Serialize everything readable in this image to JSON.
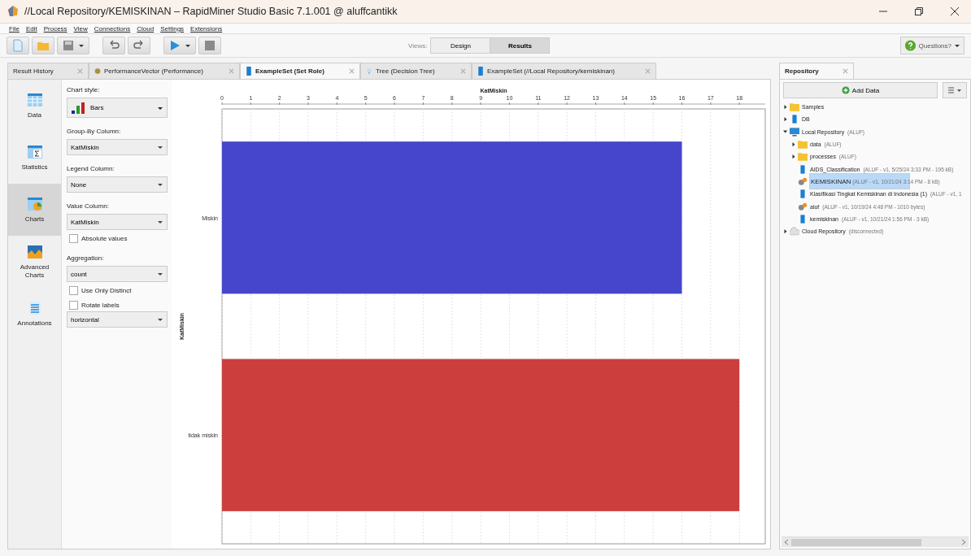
{
  "window": {
    "title": "//Local Repository/KEMISKINAN – RapidMiner Studio Basic 7.1.001 @ aluffcantikk"
  },
  "menu": [
    "File",
    "Edit",
    "Process",
    "View",
    "Connections",
    "Cloud",
    "Settings",
    "Extensions"
  ],
  "views": {
    "label": "Views:",
    "buttons": [
      {
        "label": "Design",
        "selected": false
      },
      {
        "label": "Results",
        "selected": true
      }
    ]
  },
  "questions": "Questions?",
  "result_tabs": [
    {
      "label": "Result History",
      "kind": "history",
      "selected": false
    },
    {
      "label": "PerformanceVector (Performance)",
      "kind": "performance",
      "selected": false
    },
    {
      "label": "ExampleSet (Set Role)",
      "kind": "data",
      "selected": true
    },
    {
      "label": "Tree (Decision Tree)",
      "kind": "tree",
      "selected": false
    },
    {
      "label": "ExampleSet (//Local Repository/kemiskinan)",
      "kind": "data",
      "selected": false
    }
  ],
  "nav": [
    {
      "label": "Data",
      "kind": "data",
      "selected": false
    },
    {
      "label": "Statistics",
      "kind": "statistics",
      "selected": false
    },
    {
      "label": "Charts",
      "kind": "charts",
      "selected": true
    },
    {
      "label": "Advanced Charts",
      "kind": "advanced",
      "selected": false
    },
    {
      "label": "Annotations",
      "kind": "annotations",
      "selected": false
    }
  ],
  "options": [
    {
      "kind": "style",
      "label": "Chart style:",
      "value": "Bars"
    },
    {
      "kind": "select",
      "label": "Group-By Column:",
      "value": "KatMiskin"
    },
    {
      "kind": "select",
      "label": "Legend Column:",
      "value": "None"
    },
    {
      "kind": "select",
      "label": "Value Column:",
      "value": "KatMiskin"
    },
    {
      "kind": "checkbox",
      "label": "Absolute values",
      "checked": false
    },
    {
      "kind": "select",
      "label": "Aggregation:",
      "value": "count"
    },
    {
      "kind": "checkbox",
      "label": "Use Only Distinct",
      "checked": false
    },
    {
      "kind": "checkbox",
      "label": "Rotate labels",
      "checked": false
    },
    {
      "kind": "select",
      "value": "horizontal"
    }
  ],
  "chart_data": {
    "type": "bar",
    "orientation": "horizontal",
    "xlabel": "KatMiskin",
    "ylabel": "KatMiskin",
    "categories": [
      "Miskin",
      "tidak miskin"
    ],
    "values": [
      16,
      18
    ],
    "colors": [
      "#4646cc",
      "#cc3e3e"
    ],
    "grid": true,
    "xlim": [
      0,
      18.9
    ],
    "xticks": [
      0,
      1,
      2,
      3,
      4,
      5,
      6,
      7,
      8,
      9,
      10,
      11,
      12,
      13,
      14,
      15,
      16,
      17,
      18
    ]
  },
  "repository": {
    "tab": "Repository",
    "add_data": "Add Data",
    "tree": [
      {
        "label": "Samples",
        "kind": "folder",
        "expanded": false
      },
      {
        "label": "DB",
        "kind": "db",
        "expanded": false
      },
      {
        "label": "Local Repository",
        "meta": "(ALUF)",
        "kind": "computer",
        "expanded": true,
        "children": [
          {
            "label": "data",
            "meta": "(ALUF)",
            "kind": "folder",
            "expanded": false
          },
          {
            "label": "processes",
            "meta": "(ALUF)",
            "kind": "folder",
            "expanded": false
          },
          {
            "label": "AIDS_Classification",
            "meta": "(ALUF - v1, 5/25/24 3:33 PM - 195 kB)",
            "kind": "data",
            "selected": false
          },
          {
            "label": "KEMISKINAN",
            "meta": "(ALUF - v1, 10/21/24 3:14 PM - 8 kB)",
            "kind": "process",
            "selected": true
          },
          {
            "label": "Klasifikasi Tingkat Kemiskinan di Indonesia (1)",
            "meta": "(ALUF - v1, 1",
            "kind": "data",
            "selected": false
          },
          {
            "label": "aluf",
            "meta": "(ALUF - v1, 10/19/24 4:48 PM - 1010 bytes)",
            "kind": "process",
            "selected": false
          },
          {
            "label": "kemiskinan",
            "meta": "(ALUF - v1, 10/21/24 1:56 PM - 3 kB)",
            "kind": "data",
            "selected": false
          }
        ]
      },
      {
        "label": "Cloud Repository",
        "meta": "(disconnected)",
        "kind": "cloud",
        "expanded": false
      }
    ]
  }
}
